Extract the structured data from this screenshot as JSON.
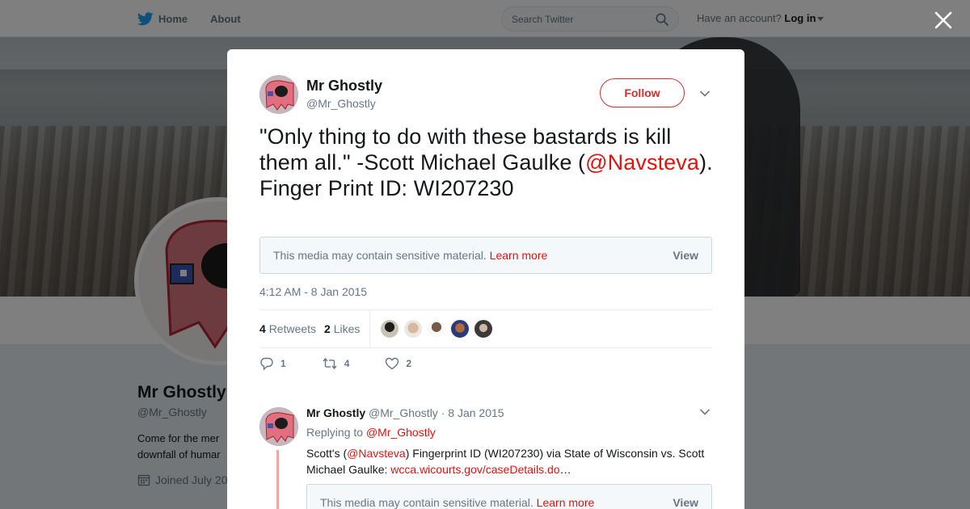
{
  "nav": {
    "home": "Home",
    "about": "About",
    "search_placeholder": "Search Twitter",
    "have_account": "Have an account?",
    "login": "Log in"
  },
  "profile": {
    "name": "Mr Ghostly",
    "handle": "@Mr_Ghostly",
    "bio_line1": "Come for the mer",
    "bio_line2": "downfall of humar",
    "joined": "Joined July 20"
  },
  "tweet": {
    "author_name": "Mr Ghostly",
    "author_handle": "@Mr_Ghostly",
    "follow_label": "Follow",
    "text_part1": "\"Only thing to do with these bastards is kill them all.\" -Scott Michael Gaulke (",
    "mention": "@Navsteva",
    "text_part2": ").",
    "text_line2": "Finger Print ID: WI207230",
    "sensitive_text": "This media may contain sensitive material.",
    "learn_more": "Learn more",
    "view_label": "View",
    "timestamp": "4:12 AM - 8 Jan 2015",
    "retweets_count": "4",
    "retweets_label": "Retweets",
    "likes_count": "2",
    "likes_label": "Likes",
    "reply_count": "1",
    "retweet_count_action": "4",
    "like_count_action": "2"
  },
  "reply": {
    "author_name": "Mr Ghostly",
    "author_handle": "@Mr_Ghostly",
    "date": "8 Jan 2015",
    "replying_to_label": "Replying to",
    "replying_to_handle": "@Mr_Ghostly",
    "text_part1": "Scott's (",
    "mention": "@Navsteva",
    "text_part2": ") Fingerprint ID (WI207230) via State of Wisconsin vs. Scott Michael Gaulke: ",
    "link": "wcca.wicourts.gov/caseDetails.do",
    "ellipsis": "…",
    "sensitive_text": "This media may contain sensitive material.",
    "learn_more": "Learn more",
    "view_label": "View"
  },
  "colors": {
    "accent": "#e0140f",
    "muted": "#657786",
    "text": "#14171a",
    "twitter_blue": "#1da1f2"
  },
  "icons": [
    "twitter-bird-icon",
    "search-icon",
    "close-icon",
    "chevron-down-icon",
    "reply-icon",
    "retweet-icon",
    "heart-icon",
    "calendar-icon"
  ]
}
